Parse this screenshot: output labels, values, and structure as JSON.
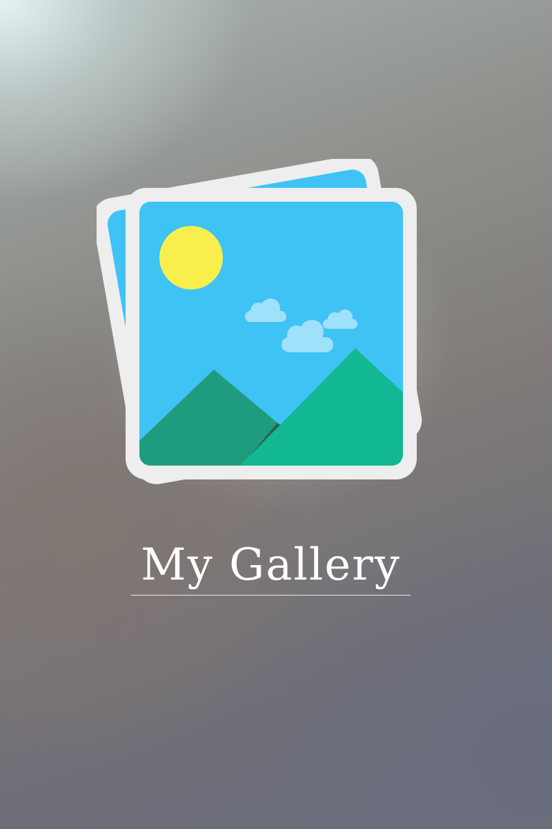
{
  "app": {
    "title": "My Gallery"
  },
  "logo": {
    "icon": "gallery-photo-stack-icon",
    "colors": {
      "frame": "#eeeeee",
      "sky": "#3fc3f4",
      "sun": "#f9ef4c",
      "cloud": "#9fe0fa",
      "mountain_left": "#1f9c7e",
      "mountain_right": "#12b893",
      "mountain_shadow": "#2b5f55"
    }
  }
}
